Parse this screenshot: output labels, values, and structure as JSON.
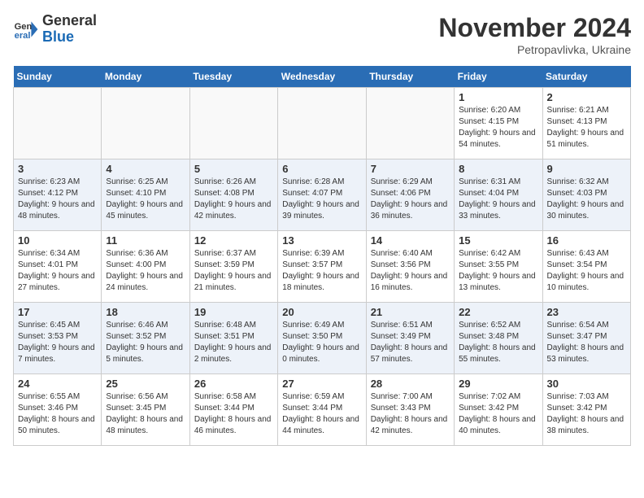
{
  "logo": {
    "text_general": "General",
    "text_blue": "Blue"
  },
  "header": {
    "month": "November 2024",
    "location": "Petropavlivka, Ukraine"
  },
  "days_of_week": [
    "Sunday",
    "Monday",
    "Tuesday",
    "Wednesday",
    "Thursday",
    "Friday",
    "Saturday"
  ],
  "weeks": [
    [
      {
        "day": "",
        "info": ""
      },
      {
        "day": "",
        "info": ""
      },
      {
        "day": "",
        "info": ""
      },
      {
        "day": "",
        "info": ""
      },
      {
        "day": "",
        "info": ""
      },
      {
        "day": "1",
        "info": "Sunrise: 6:20 AM\nSunset: 4:15 PM\nDaylight: 9 hours and 54 minutes."
      },
      {
        "day": "2",
        "info": "Sunrise: 6:21 AM\nSunset: 4:13 PM\nDaylight: 9 hours and 51 minutes."
      }
    ],
    [
      {
        "day": "3",
        "info": "Sunrise: 6:23 AM\nSunset: 4:12 PM\nDaylight: 9 hours and 48 minutes."
      },
      {
        "day": "4",
        "info": "Sunrise: 6:25 AM\nSunset: 4:10 PM\nDaylight: 9 hours and 45 minutes."
      },
      {
        "day": "5",
        "info": "Sunrise: 6:26 AM\nSunset: 4:08 PM\nDaylight: 9 hours and 42 minutes."
      },
      {
        "day": "6",
        "info": "Sunrise: 6:28 AM\nSunset: 4:07 PM\nDaylight: 9 hours and 39 minutes."
      },
      {
        "day": "7",
        "info": "Sunrise: 6:29 AM\nSunset: 4:06 PM\nDaylight: 9 hours and 36 minutes."
      },
      {
        "day": "8",
        "info": "Sunrise: 6:31 AM\nSunset: 4:04 PM\nDaylight: 9 hours and 33 minutes."
      },
      {
        "day": "9",
        "info": "Sunrise: 6:32 AM\nSunset: 4:03 PM\nDaylight: 9 hours and 30 minutes."
      }
    ],
    [
      {
        "day": "10",
        "info": "Sunrise: 6:34 AM\nSunset: 4:01 PM\nDaylight: 9 hours and 27 minutes."
      },
      {
        "day": "11",
        "info": "Sunrise: 6:36 AM\nSunset: 4:00 PM\nDaylight: 9 hours and 24 minutes."
      },
      {
        "day": "12",
        "info": "Sunrise: 6:37 AM\nSunset: 3:59 PM\nDaylight: 9 hours and 21 minutes."
      },
      {
        "day": "13",
        "info": "Sunrise: 6:39 AM\nSunset: 3:57 PM\nDaylight: 9 hours and 18 minutes."
      },
      {
        "day": "14",
        "info": "Sunrise: 6:40 AM\nSunset: 3:56 PM\nDaylight: 9 hours and 16 minutes."
      },
      {
        "day": "15",
        "info": "Sunrise: 6:42 AM\nSunset: 3:55 PM\nDaylight: 9 hours and 13 minutes."
      },
      {
        "day": "16",
        "info": "Sunrise: 6:43 AM\nSunset: 3:54 PM\nDaylight: 9 hours and 10 minutes."
      }
    ],
    [
      {
        "day": "17",
        "info": "Sunrise: 6:45 AM\nSunset: 3:53 PM\nDaylight: 9 hours and 7 minutes."
      },
      {
        "day": "18",
        "info": "Sunrise: 6:46 AM\nSunset: 3:52 PM\nDaylight: 9 hours and 5 minutes."
      },
      {
        "day": "19",
        "info": "Sunrise: 6:48 AM\nSunset: 3:51 PM\nDaylight: 9 hours and 2 minutes."
      },
      {
        "day": "20",
        "info": "Sunrise: 6:49 AM\nSunset: 3:50 PM\nDaylight: 9 hours and 0 minutes."
      },
      {
        "day": "21",
        "info": "Sunrise: 6:51 AM\nSunset: 3:49 PM\nDaylight: 8 hours and 57 minutes."
      },
      {
        "day": "22",
        "info": "Sunrise: 6:52 AM\nSunset: 3:48 PM\nDaylight: 8 hours and 55 minutes."
      },
      {
        "day": "23",
        "info": "Sunrise: 6:54 AM\nSunset: 3:47 PM\nDaylight: 8 hours and 53 minutes."
      }
    ],
    [
      {
        "day": "24",
        "info": "Sunrise: 6:55 AM\nSunset: 3:46 PM\nDaylight: 8 hours and 50 minutes."
      },
      {
        "day": "25",
        "info": "Sunrise: 6:56 AM\nSunset: 3:45 PM\nDaylight: 8 hours and 48 minutes."
      },
      {
        "day": "26",
        "info": "Sunrise: 6:58 AM\nSunset: 3:44 PM\nDaylight: 8 hours and 46 minutes."
      },
      {
        "day": "27",
        "info": "Sunrise: 6:59 AM\nSunset: 3:44 PM\nDaylight: 8 hours and 44 minutes."
      },
      {
        "day": "28",
        "info": "Sunrise: 7:00 AM\nSunset: 3:43 PM\nDaylight: 8 hours and 42 minutes."
      },
      {
        "day": "29",
        "info": "Sunrise: 7:02 AM\nSunset: 3:42 PM\nDaylight: 8 hours and 40 minutes."
      },
      {
        "day": "30",
        "info": "Sunrise: 7:03 AM\nSunset: 3:42 PM\nDaylight: 8 hours and 38 minutes."
      }
    ]
  ]
}
